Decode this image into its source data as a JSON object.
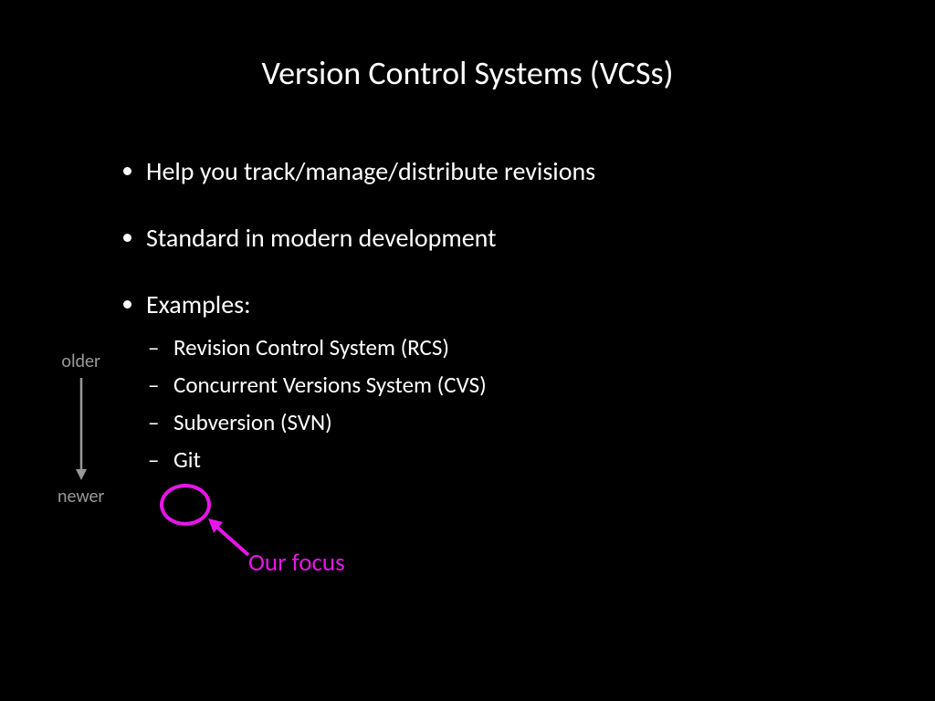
{
  "slide": {
    "title": "Version Control Systems (VCSs)",
    "bullets": [
      "Help you track/manage/distribute revisions",
      "Standard in modern development",
      "Examples:"
    ],
    "examples": [
      "Revision Control System (RCS)",
      "Concurrent Versions System (CVS)",
      "Subversion (SVN)",
      "Git"
    ],
    "timeline": {
      "top": "older",
      "bottom": "newer"
    },
    "callout": "Our focus",
    "accent_color": "#e815e8"
  }
}
